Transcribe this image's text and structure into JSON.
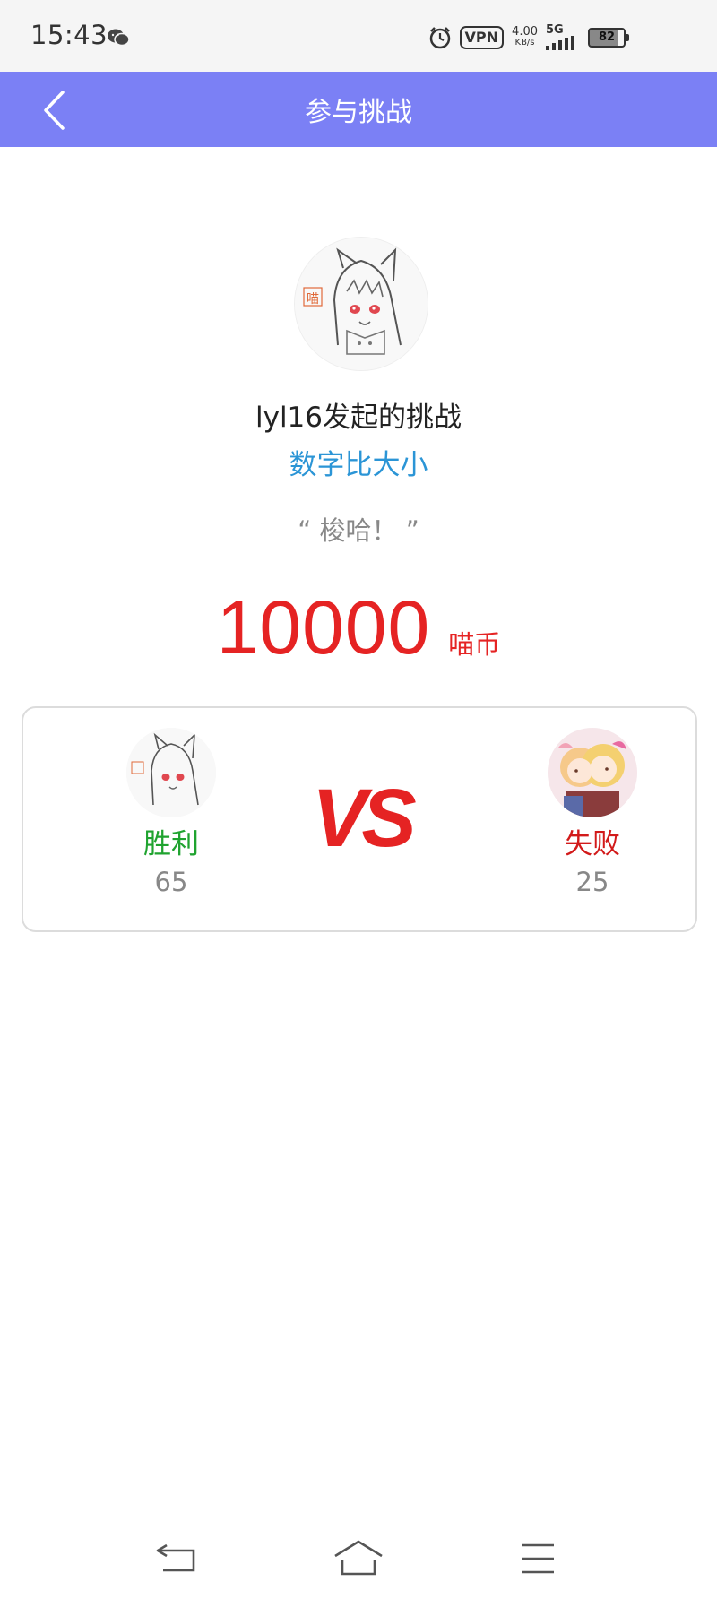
{
  "status_bar": {
    "time": "15:43",
    "vpn": "VPN",
    "net_speed_value": "4.00",
    "net_speed_unit": "KB/s",
    "network": "5G",
    "battery": "82",
    "battery_level_percent": 82,
    "icons": [
      "wechat-icon",
      "alarm-icon",
      "signal-icon",
      "battery-icon"
    ]
  },
  "header": {
    "title": "参与挑战",
    "background_color": "#7b80f5",
    "back_icon": "chevron-left-icon"
  },
  "challenge": {
    "challenger_text": "lyl16发起的挑战",
    "game_name": "数字比大小",
    "message": "“ 梭哈！ ”",
    "stake_amount": "10000",
    "stake_unit": "喵币",
    "avatar_stamp": "喵"
  },
  "vs_card": {
    "vs_text": "VS",
    "left_player": {
      "result": "胜利",
      "score": "65"
    },
    "right_player": {
      "result": "失败",
      "score": "25"
    },
    "colors": {
      "win": "#1fa32f",
      "lose": "#d21a1a",
      "vs": "#e52323"
    }
  },
  "bottom_nav": {
    "items": [
      "back-icon",
      "home-icon",
      "menu-icon"
    ]
  }
}
